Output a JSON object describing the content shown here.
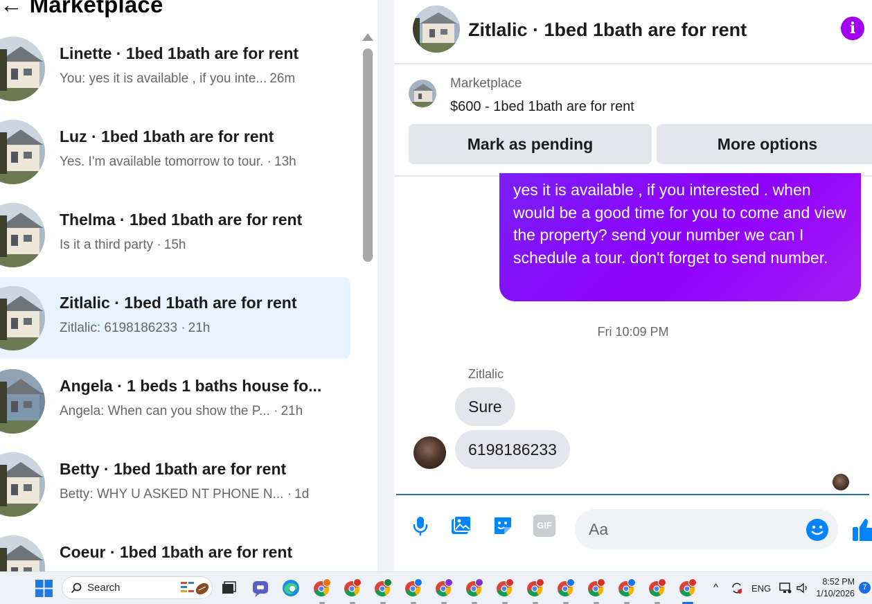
{
  "left_panel": {
    "title": "Marketplace",
    "conversations": [
      {
        "name": "Linette · 1bed 1bath are for rent",
        "snippet": "You: yes it is available , if you inte...",
        "time": "26m",
        "active": false
      },
      {
        "name": "Luz · 1bed 1bath are for rent",
        "snippet": "Yes. I'm available tomorrow to tour. ·",
        "time": "13h",
        "active": false
      },
      {
        "name": "Thelma · 1bed 1bath are for rent",
        "snippet": "Is it a third party ·",
        "time": "15h",
        "active": false
      },
      {
        "name": "Zitlalic · 1bed 1bath are for rent",
        "snippet": "Zitlalic: 6198186233 ·",
        "time": "21h",
        "active": true
      },
      {
        "name": "Angela · 1 beds 1 baths house fo...",
        "snippet": "Angela: When can you show the P... ·",
        "time": "21h",
        "active": false
      },
      {
        "name": "Betty · 1bed 1bath are for rent",
        "snippet": "Betty: WHY U ASKED NT PHONE N... ·",
        "time": "1d",
        "active": false
      },
      {
        "name": "Coeur · 1bed 1bath are for rent",
        "snippet": "",
        "time": "",
        "active": false
      }
    ]
  },
  "chat": {
    "title": "Zitlalic · 1bed 1bath are for rent",
    "info_icon": "info-icon",
    "listing": {
      "label": "Marketplace",
      "price_title": "$600 - 1bed 1bath are for rent",
      "mark_pending_label": "Mark as pending",
      "more_options_label": "More options"
    },
    "outgoing_message": "yes it is available , if you interested . when would be a good time for you to come and view the property? send your number we can I schedule a tour. don't forget to send number.",
    "timestamp": "Fri 10:09 PM",
    "sender_name": "Zitlalic",
    "incoming_messages": [
      "Sure",
      "6198186233"
    ],
    "composer": {
      "placeholder": "Aa",
      "icons": [
        "microphone-icon",
        "photo-icon",
        "sticker-icon",
        "gif-icon",
        "emoji-icon",
        "like-icon"
      ],
      "gif_label": "GIF"
    }
  },
  "taskbar": {
    "search_placeholder": "Search",
    "tray": {
      "lang": "ENG",
      "time": "8:52 PM",
      "date": "1/10/2026",
      "notifications": "7"
    },
    "pinned_apps": [
      "windows-start-icon",
      "search-box",
      "task-view-icon",
      "teams-chat-icon",
      "edge-icon",
      "chrome-profile-icons"
    ]
  },
  "colors": {
    "accent_purple": "#8f00ff",
    "active_row": "#e7f3ff",
    "button_gray": "#e4e6eb",
    "messenger_blue": "#0084ff"
  }
}
